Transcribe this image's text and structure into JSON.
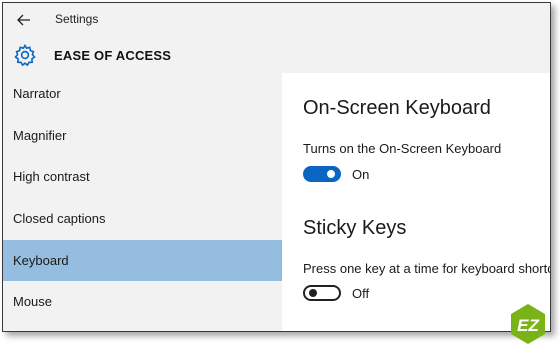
{
  "window": {
    "title": "Settings",
    "back_icon": "back-arrow-icon"
  },
  "header": {
    "icon": "gear-icon",
    "title": "EASE OF ACCESS"
  },
  "sidebar": {
    "items": [
      {
        "label": "Narrator",
        "selected": false
      },
      {
        "label": "Magnifier",
        "selected": false
      },
      {
        "label": "High contrast",
        "selected": false
      },
      {
        "label": "Closed captions",
        "selected": false
      },
      {
        "label": "Keyboard",
        "selected": true
      },
      {
        "label": "Mouse",
        "selected": false
      }
    ],
    "selected_color": "#94bde0"
  },
  "main": {
    "sections": [
      {
        "title": "On-Screen Keyboard",
        "description": "Turns on the On-Screen Keyboard",
        "toggle_state": "on",
        "toggle_label": "On"
      },
      {
        "title": "Sticky Keys",
        "description": "Press one key at a time for keyboard shortc",
        "toggle_state": "off",
        "toggle_label": "Off"
      }
    ],
    "toggle_on_color": "#0a66c2"
  },
  "logo": {
    "text": "EZ",
    "color": "#7ab317"
  }
}
